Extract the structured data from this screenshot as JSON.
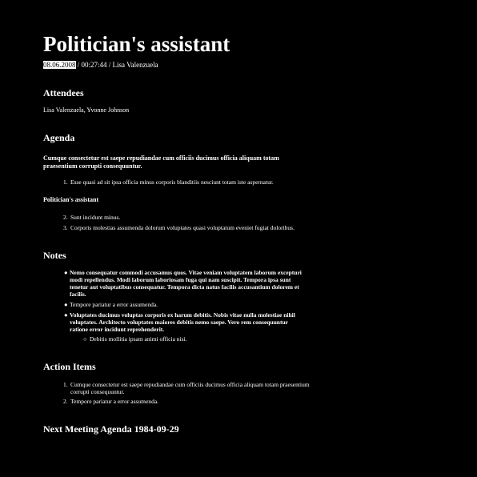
{
  "title": "Politician's assistant",
  "meta": {
    "date": "08.06.2008",
    "separator": " / ",
    "time": "00:27:44",
    "author_sep": " / ",
    "author": "Lisa Valenzuela"
  },
  "attendees": {
    "heading": "Attendees",
    "names": "Lisa Valenzuela, Yvonne Johnson"
  },
  "agenda": {
    "heading": "Agenda",
    "intro": "Cumque consectetur est saepe repudiandae cum officiis ducimus officia aliquam totam praesentium corrupti consequuntur.",
    "items1": [
      {
        "num": "1.",
        "text": "Esse quasi ad sit ipsa officia minus corporis blanditiis nesciunt totam iste aspernatur."
      }
    ],
    "subheading": "Politician's assistant",
    "items2": [
      {
        "num": "2.",
        "text": "Sunt incidunt minus."
      },
      {
        "num": "3.",
        "text": "Corporis molestias assumenda dolorum voluptates quasi voluptatum eveniet fugiat doloribus."
      }
    ]
  },
  "notes": {
    "heading": "Notes",
    "items": [
      {
        "bullet": "●",
        "text": "Nemo consequatur commodi accusamus quos. Vitae veniam voluptatem laborum excepturi modi repellendus. Modi laborum laboriosam fuga qui nam suscipit. Tempora ipsa sunt tenetur aut voluptatibus consequatur. Tempora dicta natus facilis accusantium dolorem et facilis."
      },
      {
        "bullet": "●",
        "text": "Tempore pariatur a error assumenda."
      },
      {
        "bullet": "●",
        "text": "Voluptates ducimus voluptas corporis ex harum debitis. Nobis vitae nulla molestiae nihil voluptates. Architecto voluptates maiores debitis nemo saepe. Vero rem consequuntur ratione error incidunt reprehenderit."
      }
    ],
    "subitem": {
      "bullet": "○",
      "text": "Debitis mollitia ipsam animi officia nisi."
    }
  },
  "action_items": {
    "heading": "Action Items",
    "items": [
      {
        "num": "1.",
        "text": "Cumque consectetur est saepe repudiandae cum officiis ducimus officia aliquam totam praesentium corrupti consequuntur."
      },
      {
        "num": "2.",
        "text": "Tempore pariatur a error assumenda."
      }
    ]
  },
  "next_meeting": {
    "heading": "Next Meeting Agenda 1984-09-29"
  }
}
